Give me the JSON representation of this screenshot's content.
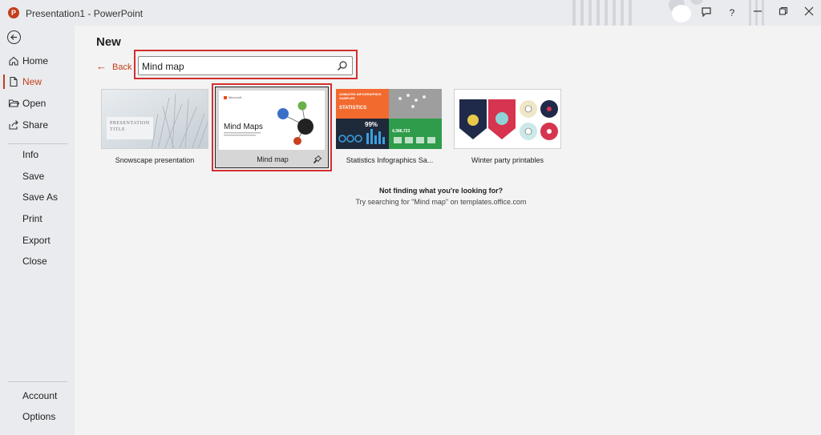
{
  "window": {
    "app_logo": "P",
    "title": "Presentation1  -  PowerPoint",
    "icons": [
      "feedback-icon",
      "help-icon",
      "minimize-icon",
      "restore-icon",
      "close-icon"
    ]
  },
  "sidebar": {
    "items": [
      {
        "label": "Home",
        "icon": "home-icon",
        "active": false
      },
      {
        "label": "New",
        "icon": "new-file-icon",
        "active": true
      },
      {
        "label": "Open",
        "icon": "folder-open-icon",
        "active": false
      },
      {
        "label": "Share",
        "icon": "share-icon",
        "active": false
      },
      {
        "label": "Info",
        "active": false
      },
      {
        "label": "Save",
        "active": false
      },
      {
        "label": "Save As",
        "active": false
      },
      {
        "label": "Print",
        "active": false
      },
      {
        "label": "Export",
        "active": false
      },
      {
        "label": "Close",
        "active": false
      },
      {
        "label": "Account",
        "active": false
      },
      {
        "label": "Options",
        "active": false
      }
    ]
  },
  "main": {
    "title": "New",
    "back_label": "Back",
    "search": {
      "value": "Mind map",
      "placeholder": ""
    },
    "templates": [
      {
        "label": "Snowscape presentation",
        "thumb_text": "PRESENTATION TITLE"
      },
      {
        "label": "Mind map",
        "thumb_title": "Mind Maps",
        "thumb_brand": "Microsoft",
        "selected": true
      },
      {
        "label": "Statistics Infographics Sa...",
        "thumb_heading": "ANIMATED INFOGRAPHICS SAMPLER",
        "thumb_title": "STATISTICS",
        "thumb_pct": "99%",
        "thumb_num": "4,386,723"
      },
      {
        "label": "Winter party printables"
      }
    ],
    "not_found_title": "Not finding what you're looking for?",
    "not_found_sub": "Try searching for \"Mind map\" on templates.office.com"
  },
  "colors": {
    "accent": "#c43e1c",
    "highlight": "#d32f2f"
  }
}
